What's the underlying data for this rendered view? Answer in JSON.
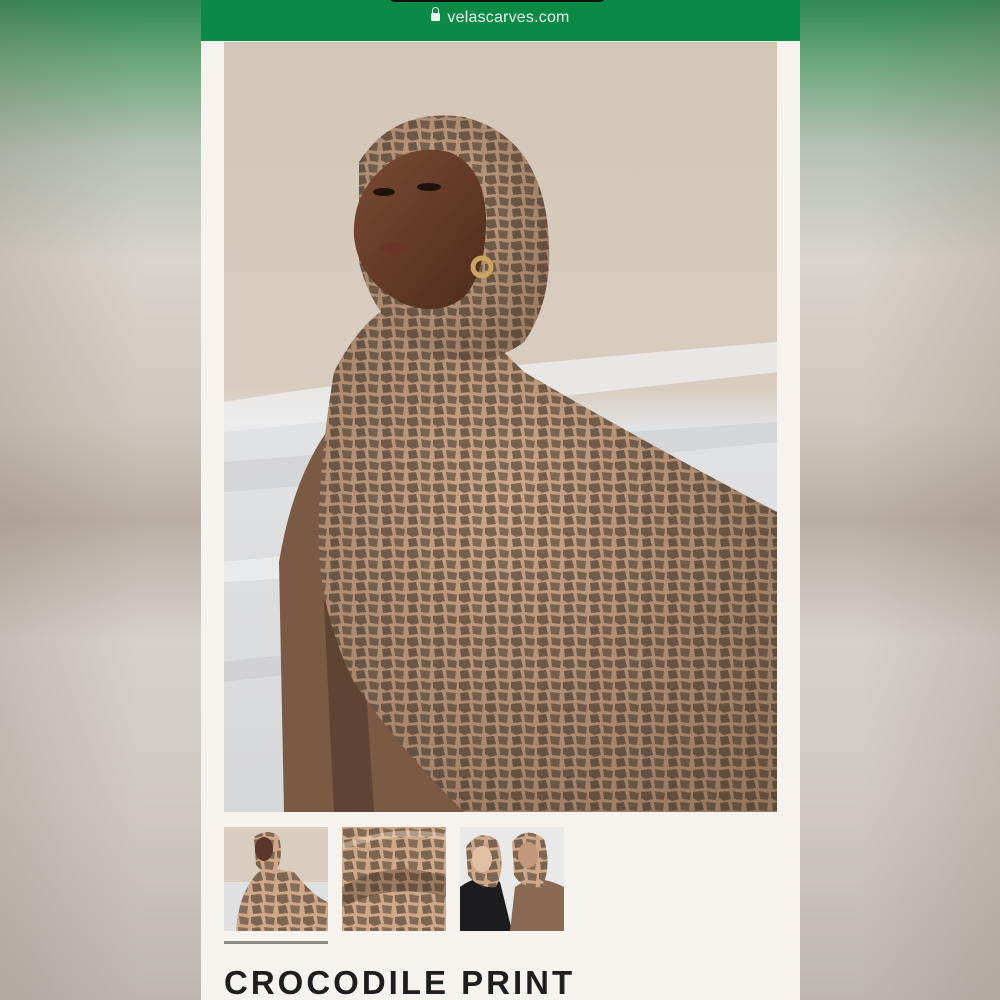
{
  "browser": {
    "url": "velascarves.com"
  },
  "product": {
    "title": "CROCODILE PRINT",
    "main_image": "model-wearing-crocodile-print-hijab",
    "thumbnails": [
      {
        "name": "model-portrait-thumbnail",
        "selected": true
      },
      {
        "name": "fabric-closeup-thumbnail",
        "selected": false
      },
      {
        "name": "two-models-thumbnail",
        "selected": false
      }
    ]
  },
  "colors": {
    "urlbar": "#0a8a45",
    "page_bg": "#f6f3ef",
    "scarf": "#8b735c",
    "backdrop_fabric": "#d8cbbc",
    "title_text": "#1e1e1e"
  }
}
